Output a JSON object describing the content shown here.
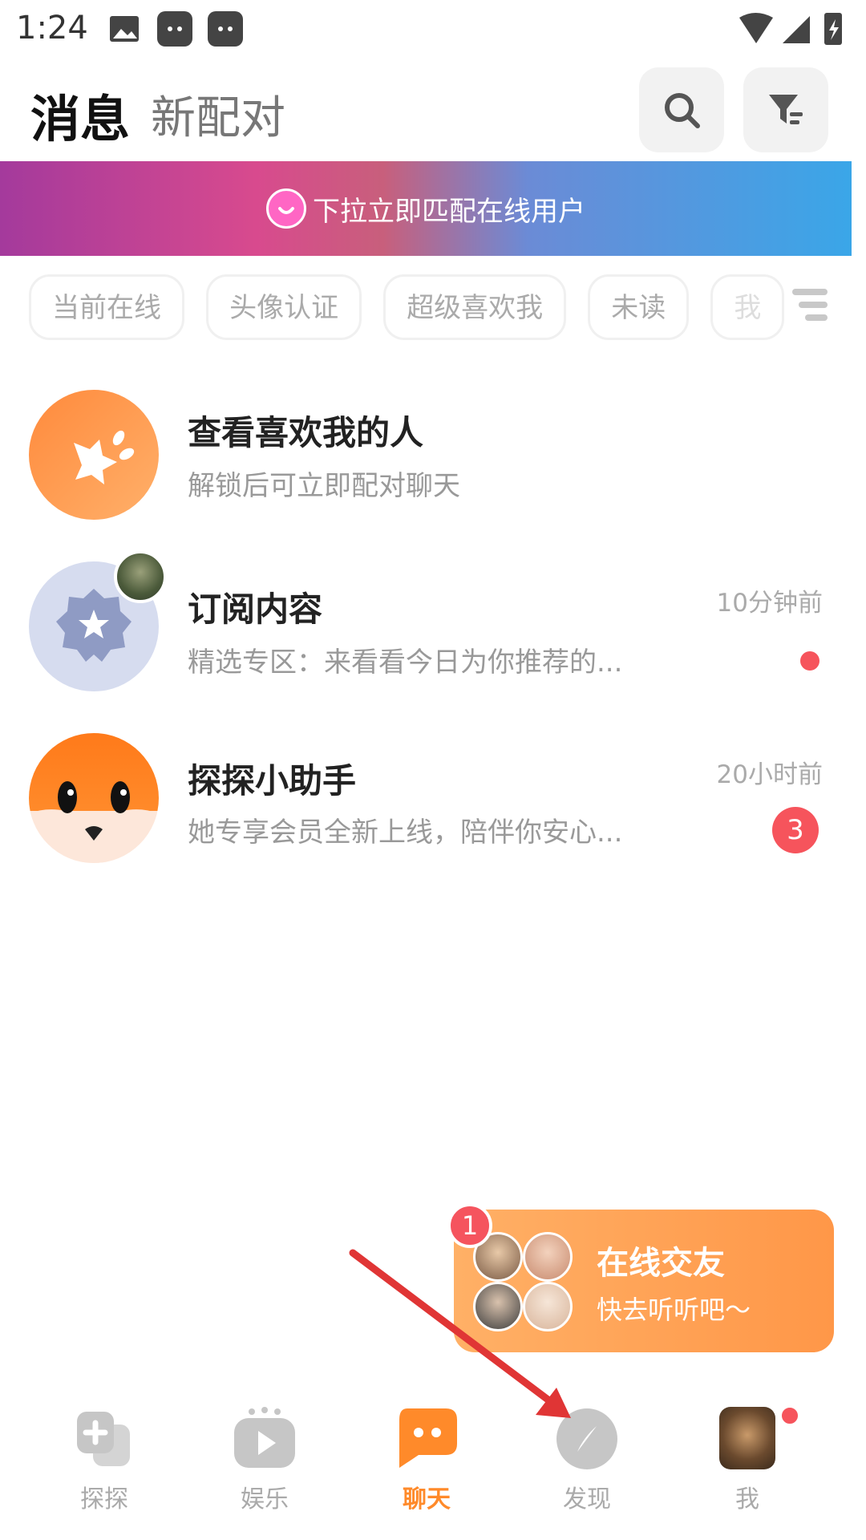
{
  "status_bar": {
    "time": "1:24"
  },
  "header": {
    "tab_active": "消息",
    "tab_inactive": "新配对"
  },
  "banner": {
    "text": "下拉立即匹配在线用户"
  },
  "filters": [
    "当前在线",
    "头像认证",
    "超级喜欢我",
    "未读",
    "我"
  ],
  "items": [
    {
      "title": "查看喜欢我的人",
      "subtitle": "解锁后可立即配对聊天",
      "time": "",
      "badge": ""
    },
    {
      "title": "订阅内容",
      "subtitle": "精选专区：来看看今日为你推荐的...",
      "time": "10分钟前",
      "badge": ""
    },
    {
      "title": "探探小助手",
      "subtitle": "她专享会员全新上线，陪伴你安心...",
      "time": "20小时前",
      "badge": "3"
    }
  ],
  "float_card": {
    "count": "1",
    "title": "在线交友",
    "subtitle": "快去听听吧～"
  },
  "nav": [
    {
      "label": "探探",
      "icon": "cards-icon"
    },
    {
      "label": "娱乐",
      "icon": "tv-play-icon"
    },
    {
      "label": "聊天",
      "icon": "chat-bubble-icon"
    },
    {
      "label": "发现",
      "icon": "compass-icon"
    },
    {
      "label": "我",
      "icon": "profile-avatar"
    }
  ],
  "colors": {
    "accent": "#ff8a2a",
    "badge": "#f6545c",
    "annotation_arrow": "#e03535"
  }
}
